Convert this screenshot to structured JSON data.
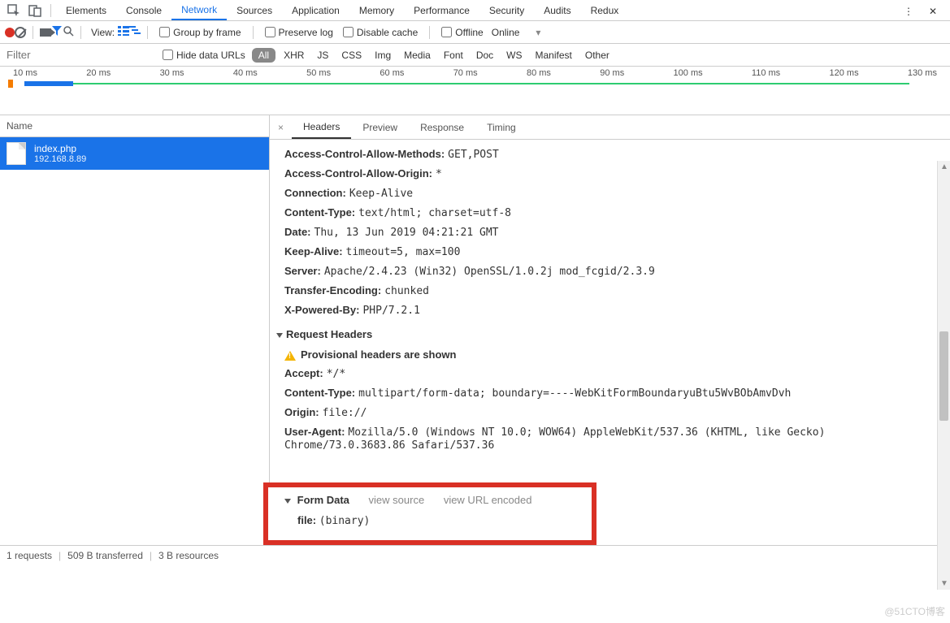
{
  "topTabs": [
    "Elements",
    "Console",
    "Network",
    "Sources",
    "Application",
    "Memory",
    "Performance",
    "Security",
    "Audits",
    "Redux"
  ],
  "topActiveIndex": 2,
  "toolbar": {
    "viewLabel": "View:",
    "groupByFrame": "Group by frame",
    "preserveLog": "Preserve log",
    "disableCache": "Disable cache",
    "offline": "Offline",
    "online": "Online"
  },
  "filterBar": {
    "placeholder": "Filter",
    "hideDataUrls": "Hide data URLs",
    "types": [
      "All",
      "XHR",
      "JS",
      "CSS",
      "Img",
      "Media",
      "Font",
      "Doc",
      "WS",
      "Manifest",
      "Other"
    ],
    "activeType": 0
  },
  "timelineTicks": [
    "10 ms",
    "20 ms",
    "30 ms",
    "40 ms",
    "50 ms",
    "60 ms",
    "70 ms",
    "80 ms",
    "90 ms",
    "100 ms",
    "110 ms",
    "120 ms",
    "130 ms"
  ],
  "nameHeader": "Name",
  "request": {
    "file": "index.php",
    "host": "192.168.8.89"
  },
  "detailsTabs": [
    "Headers",
    "Preview",
    "Response",
    "Timing"
  ],
  "detailsActive": 0,
  "responseHeaders": [
    {
      "k": "Access-Control-Allow-Methods:",
      "v": "GET,POST"
    },
    {
      "k": "Access-Control-Allow-Origin:",
      "v": "*"
    },
    {
      "k": "Connection:",
      "v": "Keep-Alive"
    },
    {
      "k": "Content-Type:",
      "v": "text/html; charset=utf-8"
    },
    {
      "k": "Date:",
      "v": "Thu, 13 Jun 2019 04:21:21 GMT"
    },
    {
      "k": "Keep-Alive:",
      "v": "timeout=5, max=100"
    },
    {
      "k": "Server:",
      "v": "Apache/2.4.23 (Win32) OpenSSL/1.0.2j mod_fcgid/2.3.9"
    },
    {
      "k": "Transfer-Encoding:",
      "v": "chunked"
    },
    {
      "k": "X-Powered-By:",
      "v": "PHP/7.2.1"
    }
  ],
  "requestHeadersTitle": "Request Headers",
  "provisional": "Provisional headers are shown",
  "requestHeaders": [
    {
      "k": "Accept:",
      "v": "*/*"
    },
    {
      "k": "Content-Type:",
      "v": "multipart/form-data; boundary=----WebKitFormBoundaryuBtu5WvBObAmvDvh"
    },
    {
      "k": "Origin:",
      "v": "file://"
    },
    {
      "k": "User-Agent:",
      "v": "Mozilla/5.0 (Windows NT 10.0; WOW64) AppleWebKit/537.36 (KHTML, like Gecko) Chrome/73.0.3683.86 Safari/537.36"
    }
  ],
  "formData": {
    "title": "Form Data",
    "viewSource": "view source",
    "viewUrlEncoded": "view URL encoded",
    "file_k": "file:",
    "file_v": "(binary)"
  },
  "status": {
    "requests": "1 requests",
    "transferred": "509 B transferred",
    "resources": "3 B resources"
  },
  "watermark": "@51CTO博客"
}
